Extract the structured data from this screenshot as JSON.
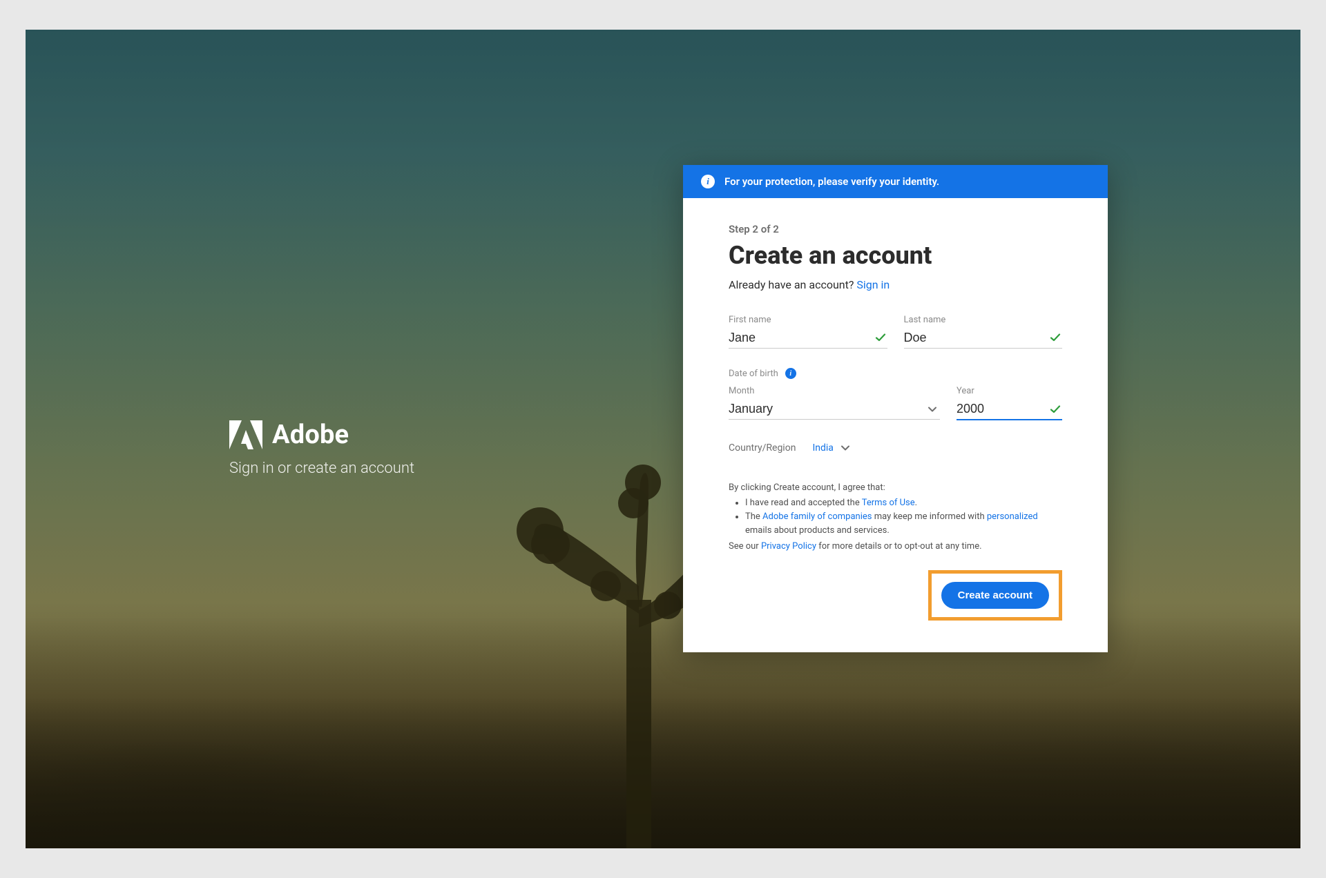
{
  "brand": {
    "name": "Adobe",
    "tagline": "Sign in or create an account"
  },
  "verify_banner": {
    "text": "For your protection, please verify your identity."
  },
  "form": {
    "step_label": "Step 2 of 2",
    "title": "Create an account",
    "already_text": "Already have an account? ",
    "signin_link": "Sign in",
    "first_name": {
      "label": "First name",
      "value": "Jane"
    },
    "last_name": {
      "label": "Last name",
      "value": "Doe"
    },
    "dob": {
      "section_label": "Date of birth",
      "month": {
        "label": "Month",
        "value": "January"
      },
      "year": {
        "label": "Year",
        "value": "2000"
      }
    },
    "country": {
      "label": "Country/Region",
      "value": "India"
    },
    "legal": {
      "intro": "By clicking Create account, I agree that:",
      "bullet1_prefix": "I have read and accepted the ",
      "bullet1_link": "Terms of Use",
      "bullet1_suffix": ".",
      "bullet2_prefix": "The ",
      "bullet2_link1": "Adobe family of companies",
      "bullet2_mid": " may keep me informed with ",
      "bullet2_link2": "personalized",
      "bullet2_suffix": " emails about products and services.",
      "footer_prefix": "See our ",
      "footer_link": "Privacy Policy",
      "footer_suffix": " for more details or to opt-out at any time."
    },
    "submit_label": "Create account"
  },
  "colors": {
    "accent": "#1473e6",
    "highlight": "#f29d2f",
    "success": "#2d9d3a"
  }
}
